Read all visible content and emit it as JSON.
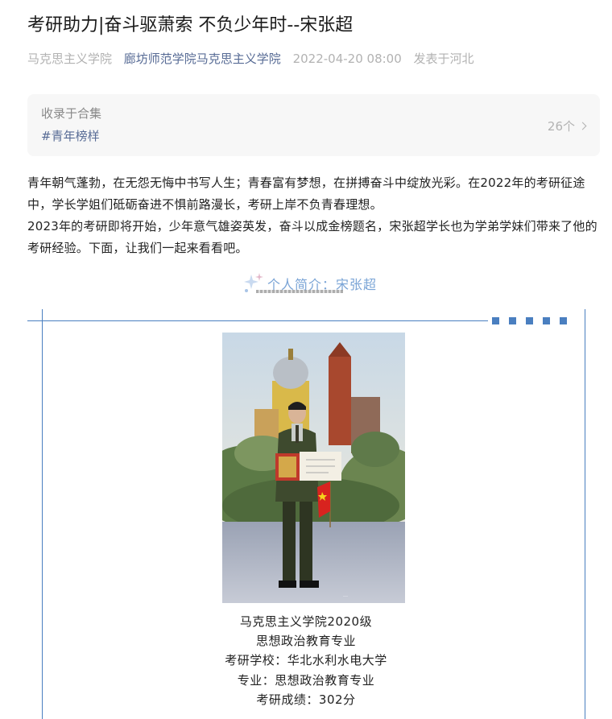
{
  "article": {
    "title": "考研助力|奋斗驱萧索 不负少年时--宋张超",
    "author": "马克思主义学院",
    "account": "廊坊师范学院马克思主义学院",
    "datetime": "2022-04-20 08:00",
    "location": "发表于河北"
  },
  "album": {
    "label": "收录于合集",
    "tag": "#青年榜样",
    "count": "26个"
  },
  "body": {
    "paragraph1": "青年朝气蓬勃，在无怨无悔中书写人生；青春富有梦想，在拼搏奋斗中绽放光彩。在2022年的考研征途中，学长学姐们砥砺奋进不惧前路漫长，考研上岸不负青春理想。",
    "paragraph2": "2023年的考研即将开始，少年意气雄姿英发，奋斗以成金榜题名，宋张超学长也为学弟学妹们带来了他的考研经验。下面，让我们一起来看看吧。"
  },
  "section": {
    "heading": "个人简介：宋张超"
  },
  "profile": {
    "line1": "马克思主义学院2020级",
    "line2": "思想政治教育专业",
    "line3": "考研学校：华北水利水电大学",
    "line4": "专业：思想政治教育专业",
    "line5": "考研成绩：302分"
  },
  "colors": {
    "accent": "#4a7fc0",
    "link": "#576b95",
    "meta": "#b2b2b2"
  }
}
